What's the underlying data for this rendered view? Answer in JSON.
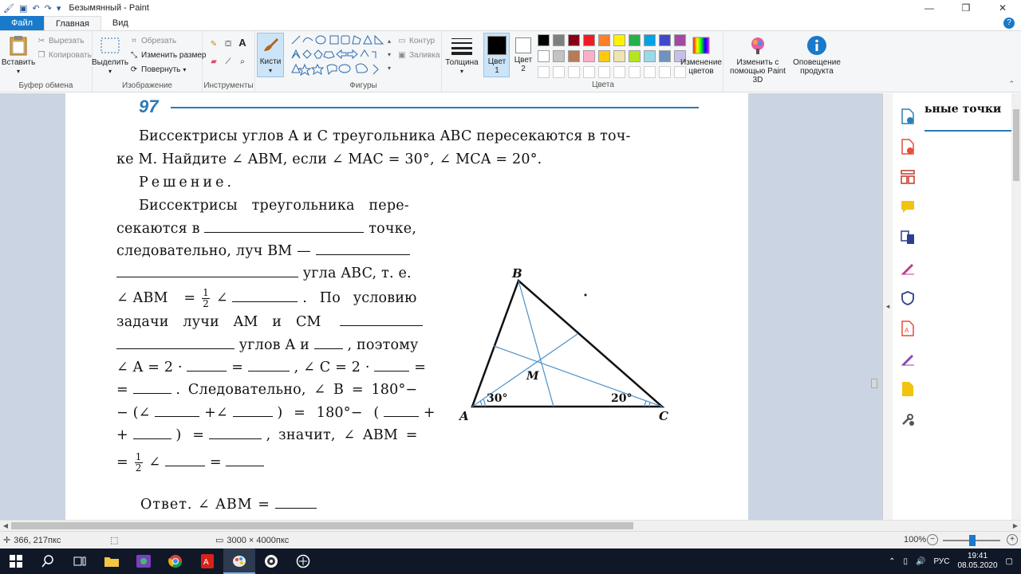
{
  "window": {
    "title": "Безымянный - Paint"
  },
  "tabs": {
    "file": "Файл",
    "home": "Главная",
    "view": "Вид"
  },
  "ribbon": {
    "clipboard": {
      "label": "Буфер обмена",
      "paste": "Вставить",
      "cut": "Вырезать",
      "copy": "Копировать"
    },
    "image": {
      "label": "Изображение",
      "select": "Выделить",
      "crop": "Обрезать",
      "resize": "Изменить размер",
      "rotate": "Повернуть"
    },
    "tools": {
      "label": "Инструменты"
    },
    "brushes": {
      "label": "Кисти"
    },
    "shapes": {
      "label": "Фигуры",
      "outline": "Контур",
      "fill": "Заливка"
    },
    "size": {
      "label": "Толщина"
    },
    "colors": {
      "label": "Цвета",
      "color1": "Цвет 1",
      "color2": "Цвет 2",
      "edit": "Изменение цветов",
      "row1": [
        "#000000",
        "#7f7f7f",
        "#880015",
        "#ed1c24",
        "#ff7f27",
        "#fff200",
        "#22b14c",
        "#00a2e8",
        "#3f48cc",
        "#a349a4"
      ],
      "row2": [
        "#ffffff",
        "#c3c3c3",
        "#b97a57",
        "#ffaec9",
        "#ffc90e",
        "#efe4b0",
        "#b5e61d",
        "#99d9ea",
        "#7092be",
        "#c8bfe7"
      ]
    },
    "paint3d": "Изменить с помощью Paint 3D",
    "notify": "Оповещение продукта"
  },
  "document": {
    "problem_number": "97",
    "lines": {
      "l1": "Биссектрисы углов A и C треугольника ABC пересекаются в точ-",
      "l2": "ке M. Найдите ∠ ABM, если ∠ MAC = 30°, ∠ MCA = 20°.",
      "l3": "Решение.",
      "l4": "Биссектрисы треугольника пере-",
      "l5a": "секаются в",
      "l5b": "точке,",
      "l6a": "следовательно, луч BM —",
      "l7a": "угла ABC, т. е.",
      "l8a": "∠ ABM",
      "l8b": "= ",
      "l8c": "∠",
      "l8d": ". По условию",
      "l9a": "задачи лучи AM и CM",
      "l10a": "углов A и",
      "l10b": ", поэтому",
      "l11a": "∠ A = 2 ·",
      "l11b": "=",
      "l11c": ", ∠ C = 2 ·",
      "l11d": "=",
      "l12a": "=",
      "l12b": ". Следовательно, ∠ B = 180°−",
      "l13a": "− (∠",
      "l13b": "+∠",
      "l13c": ") = 180°− (",
      "l13d": "+",
      "l14a": "+",
      "l14b": ") =",
      "l14c": ", значит, ∠ ABM =",
      "l15a": "=",
      "l15b": "∠",
      "l15c": "=",
      "l16a": "Ответ. ∠ ABM ="
    },
    "frac_num": "1",
    "frac_den": "2",
    "figure": {
      "vertex_a": "A",
      "vertex_b": "B",
      "vertex_c": "C",
      "point_m": "M",
      "angle_a": "30°",
      "angle_c": "20°"
    }
  },
  "side_panel": {
    "peek_text": "ьные точки"
  },
  "status": {
    "cursor": "366, 217пкс",
    "dimensions": "3000 × 4000пкс",
    "zoom": "100%"
  },
  "taskbar": {
    "lang": "РУС",
    "time": "19:41",
    "date": "08.05.2020"
  }
}
